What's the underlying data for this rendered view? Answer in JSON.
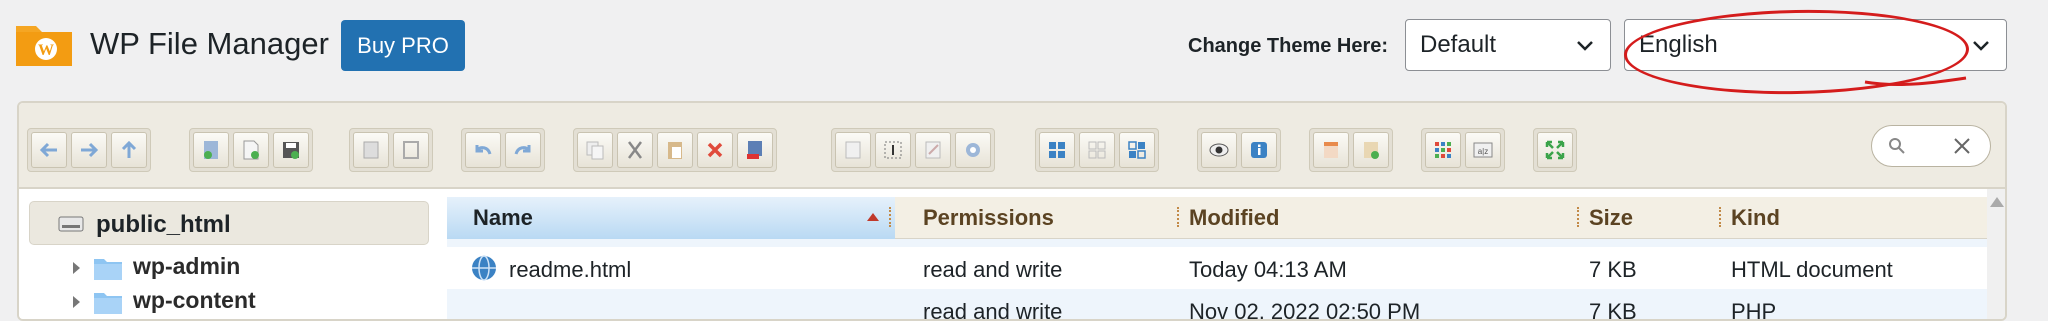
{
  "header": {
    "app_title": "WP File Manager",
    "buy_label": "Buy PRO",
    "theme_label": "Change Theme Here:",
    "theme_value": "Default",
    "language_value": "English"
  },
  "toolbar": {
    "search_placeholder": "",
    "icons": [
      "back-icon",
      "forward-icon",
      "up-icon",
      "reload-icon",
      "new-file-icon",
      "save-icon",
      "open-icon",
      "download-icon",
      "undo-icon",
      "redo-icon",
      "copy-icon",
      "cut-icon",
      "paste-icon",
      "delete-icon",
      "empty-icon",
      "duplicate-icon",
      "rename-icon",
      "edit-icon",
      "resize-icon",
      "select-all-icon",
      "select-none-icon",
      "invert-selection-icon",
      "preview-icon",
      "info-icon",
      "extract-icon",
      "archive-icon",
      "view-icon",
      "sort-icon",
      "fullscreen-icon"
    ]
  },
  "tree": {
    "root": "public_html",
    "items": [
      "wp-admin",
      "wp-content"
    ]
  },
  "list": {
    "columns": [
      "Name",
      "Permissions",
      "Modified",
      "Size",
      "Kind"
    ],
    "rows": [
      {
        "name": "readme.html",
        "permissions": "read and write",
        "modified": "Today 04:13 AM",
        "size": "7 KB",
        "kind": "HTML document"
      }
    ],
    "partial_row": {
      "name": "...",
      "permissions": "read and write",
      "modified": "Nov 02, 2022 02:50 PM",
      "size": "7 KB",
      "kind": "PHP"
    }
  },
  "colors": {
    "accent": "#2271b1",
    "annotation": "#d41c1c",
    "header_text": "#5b4322"
  }
}
